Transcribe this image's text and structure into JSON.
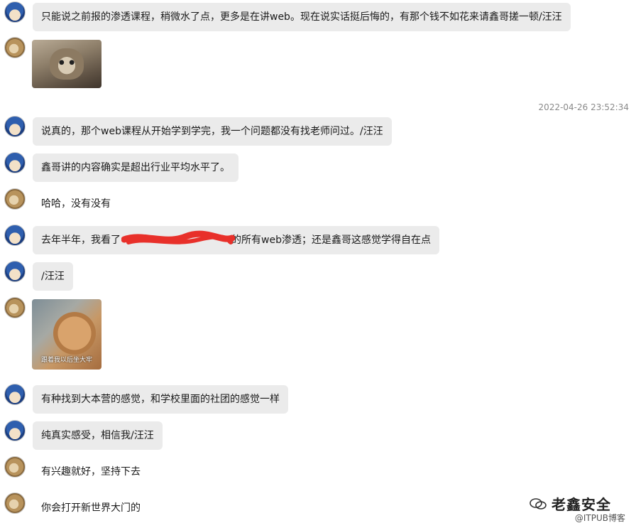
{
  "timestamp": "2022-04-26 23:52:34",
  "messages": [
    {
      "text": "只能说之前报的渗透课程，稍微水了点，更多是在讲web。现在说实话挺后悔的，有那个钱不如花来请鑫哥搓一顿/汪汪"
    },
    {
      "text": "说真的，那个web课程从开始学到学完，我一个问题都没有找老师问过。/汪汪"
    },
    {
      "text": "鑫哥讲的内容确实是超出行业平均水平了。"
    },
    {
      "text": "哈哈，没有没有"
    },
    {
      "text_before": "去年半年，我看了",
      "text_after": "的所有web渗透；还是鑫哥这感觉学得自在点"
    },
    {
      "text": "/汪汪"
    },
    {
      "text": "有种找到大本营的感觉，和学校里面的社团的感觉一样"
    },
    {
      "text": "纯真实感受，相信我/汪汪"
    },
    {
      "text": "有兴趣就好，坚持下去"
    },
    {
      "text": "你会打开新世界大门的"
    }
  ],
  "image2_caption": "跟着我以后坐大牢",
  "watermark": {
    "brand": "老鑫安全",
    "source": "@ITPUB博客"
  },
  "colors": {
    "bubble": "#ebebeb",
    "timestamp": "#8a8a8a",
    "redact": "#e8302a"
  }
}
